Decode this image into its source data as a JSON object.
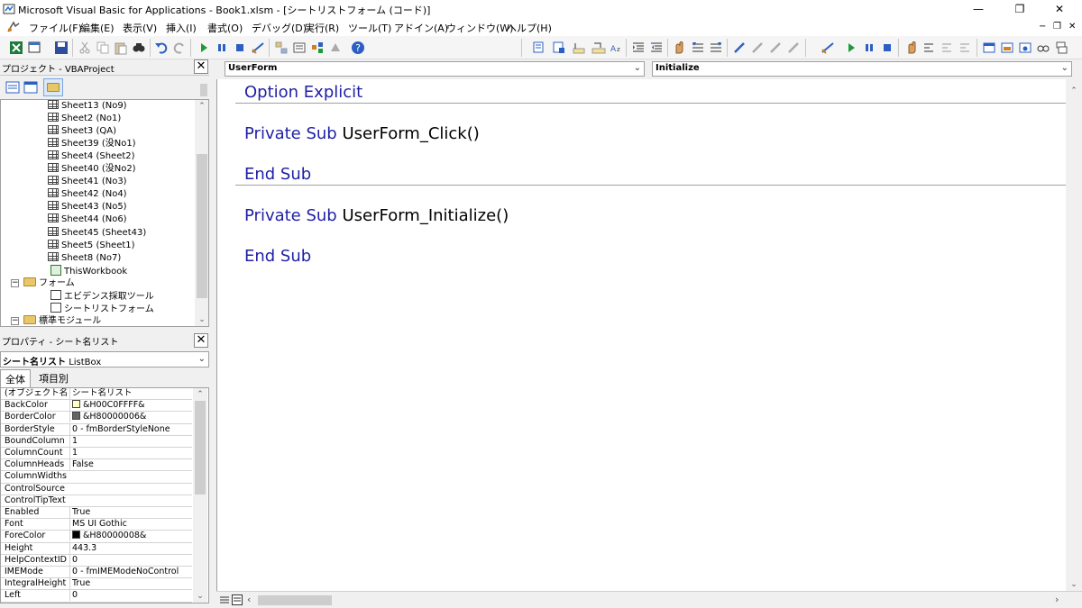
{
  "window": {
    "title": "Microsoft Visual Basic for Applications - Book1.xlsm - [シートリストフォーム (コード)]",
    "minimize": "—",
    "restore": "❐",
    "close": "✕"
  },
  "menu": {
    "items": [
      {
        "label": "ファイル(F)"
      },
      {
        "label": "編集(E)"
      },
      {
        "label": "表示(V)"
      },
      {
        "label": "挿入(I)"
      },
      {
        "label": "書式(O)"
      },
      {
        "label": "デバッグ(D)"
      },
      {
        "label": "実行(R)"
      },
      {
        "label": "ツール(T)"
      },
      {
        "label": "アドイン(A)"
      },
      {
        "label": "ウィンドウ(W)"
      },
      {
        "label": "ヘルプ(H)"
      }
    ],
    "doc_min": "−",
    "doc_restore": "❐",
    "doc_close": "✕"
  },
  "project": {
    "title": "プロジェクト - VBAProject",
    "close": "✕",
    "items": [
      {
        "label": "Sheet13 (No9)",
        "kind": "sheet"
      },
      {
        "label": "Sheet2 (No1)",
        "kind": "sheet"
      },
      {
        "label": "Sheet3 (QA)",
        "kind": "sheet"
      },
      {
        "label": "Sheet39 (没No1)",
        "kind": "sheet"
      },
      {
        "label": "Sheet4 (Sheet2)",
        "kind": "sheet"
      },
      {
        "label": "Sheet40 (没No2)",
        "kind": "sheet"
      },
      {
        "label": "Sheet41 (No3)",
        "kind": "sheet"
      },
      {
        "label": "Sheet42 (No4)",
        "kind": "sheet"
      },
      {
        "label": "Sheet43 (No5)",
        "kind": "sheet"
      },
      {
        "label": "Sheet44 (No6)",
        "kind": "sheet"
      },
      {
        "label": "Sheet45 (Sheet43)",
        "kind": "sheet"
      },
      {
        "label": "Sheet5 (Sheet1)",
        "kind": "sheet"
      },
      {
        "label": "Sheet8 (No7)",
        "kind": "sheet"
      },
      {
        "label": "ThisWorkbook",
        "kind": "workbook"
      },
      {
        "label": "フォーム",
        "kind": "folder"
      },
      {
        "label": "エビデンス採取ツール",
        "kind": "form"
      },
      {
        "label": "シートリストフォーム",
        "kind": "form"
      },
      {
        "label": "標準モジュール",
        "kind": "folder"
      }
    ]
  },
  "properties": {
    "title": "プロパティ - シート名リスト",
    "close": "✕",
    "object_name": "シート名リスト",
    "object_type": "ListBox",
    "tabs": [
      {
        "label": "全体"
      },
      {
        "label": "項目別"
      }
    ],
    "rows": [
      {
        "name": "(オブジェクト名)",
        "value": "シート名リスト",
        "swatch": ""
      },
      {
        "name": "BackColor",
        "value": "&H00C0FFFF&",
        "swatch": "#ffffc0"
      },
      {
        "name": "BorderColor",
        "value": "&H80000006&",
        "swatch": "#646464"
      },
      {
        "name": "BorderStyle",
        "value": "0 - fmBorderStyleNone",
        "swatch": ""
      },
      {
        "name": "BoundColumn",
        "value": "1",
        "swatch": ""
      },
      {
        "name": "ColumnCount",
        "value": "1",
        "swatch": ""
      },
      {
        "name": "ColumnHeads",
        "value": "False",
        "swatch": ""
      },
      {
        "name": "ColumnWidths",
        "value": "",
        "swatch": ""
      },
      {
        "name": "ControlSource",
        "value": "",
        "swatch": ""
      },
      {
        "name": "ControlTipText",
        "value": "",
        "swatch": ""
      },
      {
        "name": "Enabled",
        "value": "True",
        "swatch": ""
      },
      {
        "name": "Font",
        "value": "MS UI Gothic",
        "swatch": ""
      },
      {
        "name": "ForeColor",
        "value": "&H80000008&",
        "swatch": "#000000"
      },
      {
        "name": "Height",
        "value": "443.3",
        "swatch": ""
      },
      {
        "name": "HelpContextID",
        "value": "0",
        "swatch": ""
      },
      {
        "name": "IMEMode",
        "value": "0 - fmIMEModeNoControl",
        "swatch": ""
      },
      {
        "name": "IntegralHeight",
        "value": "True",
        "swatch": ""
      },
      {
        "name": "Left",
        "value": "0",
        "swatch": ""
      }
    ]
  },
  "code": {
    "object_combo": "UserForm",
    "proc_combo": "Initialize",
    "lines": [
      {
        "kw": "Option Explicit",
        "ident": ""
      },
      {
        "kw": "Private Sub ",
        "ident": "UserForm_Click()"
      },
      {
        "kw": "End Sub",
        "ident": ""
      },
      {
        "kw": "Private Sub ",
        "ident": "UserForm_Initialize()"
      },
      {
        "kw": "End Sub",
        "ident": ""
      }
    ]
  }
}
